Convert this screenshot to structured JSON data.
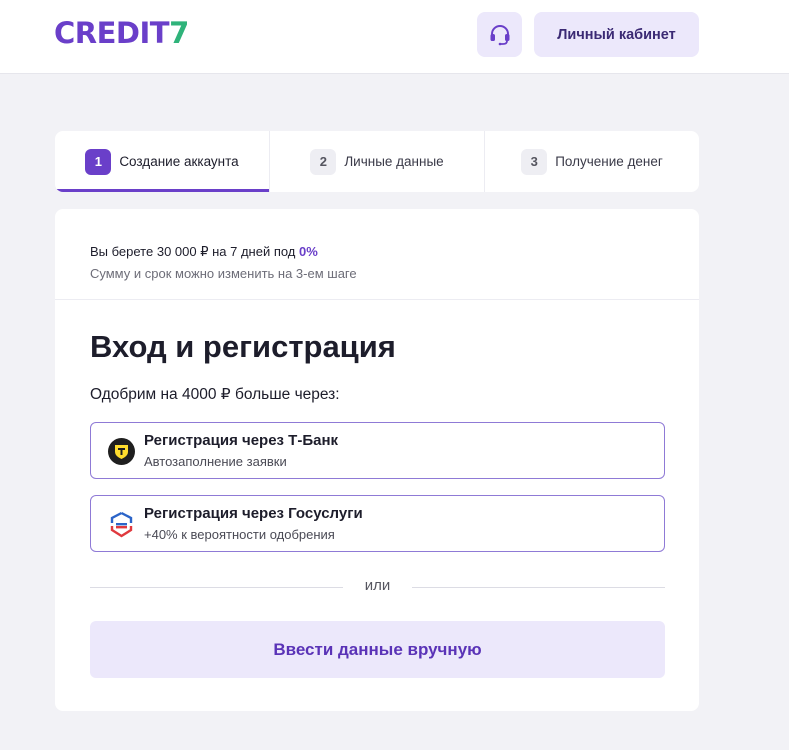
{
  "header": {
    "logo_part1": "CREDIT",
    "logo_part2": "7",
    "support_icon": "headset-icon",
    "cabinet_label": "Личный кабинет"
  },
  "steps": [
    {
      "num": "1",
      "label": "Создание аккаунта",
      "active": true
    },
    {
      "num": "2",
      "label": "Личные данные",
      "active": false
    },
    {
      "num": "3",
      "label": "Получение денег",
      "active": false
    }
  ],
  "info": {
    "line1_prefix": "Вы берете 30 000 ₽ на 7 дней под",
    "line1_pct": "0%",
    "line2": "Сумму и срок можно изменить на 3-ем шаге"
  },
  "main": {
    "title": "Вход и регистрация",
    "subtitle": "Одобрим на 4000 ₽ больше через:",
    "options": [
      {
        "icon": "tbank-icon",
        "title": "Регистрация через Т-Банк",
        "desc": "Автозаполнение заявки"
      },
      {
        "icon": "gosuslugi-icon",
        "title": "Регистрация через Госуслуги",
        "desc": "+40% к вероятности одобрения"
      }
    ],
    "or_label": "или",
    "manual_label": "Ввести данные вручную"
  },
  "colors": {
    "brand_purple": "#6a3fc9",
    "brand_green": "#2fb37a",
    "button_bg": "#ece8fb"
  }
}
